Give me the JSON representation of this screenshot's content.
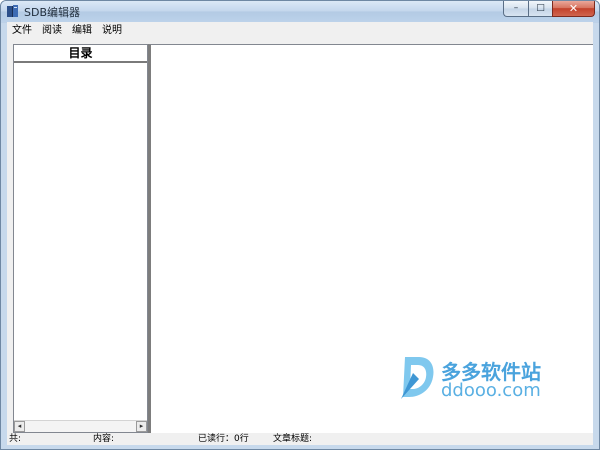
{
  "window": {
    "title": "SDB编辑器",
    "min_glyph": "–",
    "max_glyph": "□",
    "close_glyph": "✕"
  },
  "menu": {
    "items": [
      {
        "label": "文件"
      },
      {
        "label": "阅读"
      },
      {
        "label": "编辑"
      },
      {
        "label": "说明"
      }
    ]
  },
  "directory": {
    "header": "目录",
    "scroll_left_glyph": "◂",
    "scroll_right_glyph": "▸"
  },
  "status": {
    "total": "共:",
    "content": "内容:",
    "read_lines": "已读行：0行",
    "article_title": "文章标题:"
  },
  "watermark": {
    "brand_cn": "多多软件站",
    "brand_en": "ddooo.com"
  },
  "colors": {
    "watermark_blue": "#4aa3dd",
    "close_red": "#c2412b"
  }
}
